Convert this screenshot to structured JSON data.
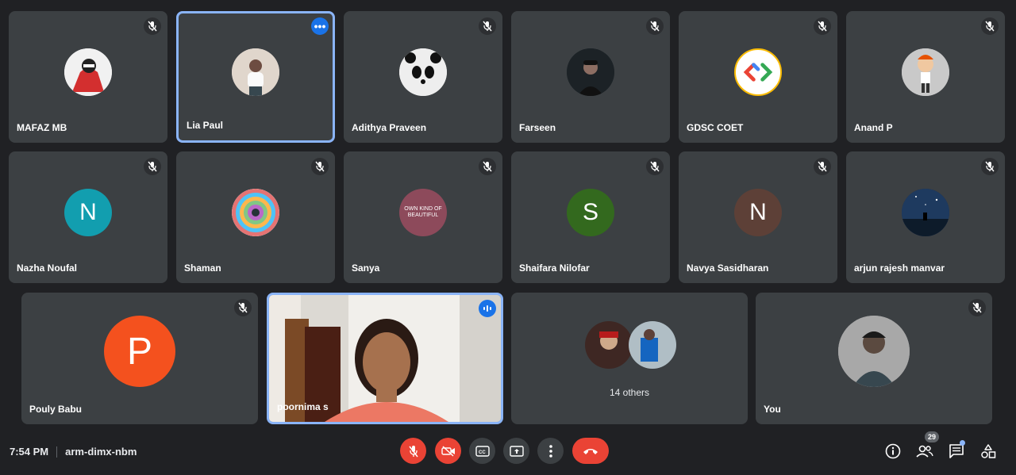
{
  "participants": [
    {
      "name": "MAFAZ MB",
      "avatar": "hacker-illustration",
      "muted": true
    },
    {
      "name": "Lia Paul",
      "avatar": "photo",
      "muted": false,
      "pinned": true
    },
    {
      "name": "Adithya Praveen",
      "avatar": "panda-photo",
      "muted": true
    },
    {
      "name": "Farseen",
      "avatar": "photo",
      "muted": true
    },
    {
      "name": "GDSC COET",
      "avatar": "gdsc-logo",
      "muted": true
    },
    {
      "name": "Anand P",
      "avatar": "cartoon",
      "muted": true
    },
    {
      "name": "Nazha Noufal",
      "initial": "N",
      "color": "#129eaf",
      "muted": true
    },
    {
      "name": "Shaman",
      "avatar": "spiral-pattern",
      "muted": true
    },
    {
      "name": "Sanya",
      "avatar": "text-image",
      "avatar_text": "OWN KIND OF BEAUTIFUL",
      "muted": true
    },
    {
      "name": "Shaifara Nilofar",
      "initial": "S",
      "color": "#33691e",
      "muted": true
    },
    {
      "name": "Navya Sasidharan",
      "initial": "N",
      "color": "#5d4037",
      "muted": true
    },
    {
      "name": "arjun rajesh manvar",
      "avatar": "night-scene",
      "muted": true
    },
    {
      "name": "Pouly Babu",
      "initial": "P",
      "color": "#f4511e",
      "muted": true
    },
    {
      "name": "poornima s",
      "video": true,
      "speaking": true
    },
    {
      "name": "You",
      "avatar": "photo",
      "muted": true
    }
  ],
  "others": {
    "label": "14 others"
  },
  "meeting": {
    "time": "7:54 PM",
    "code": "arm-dimx-nbm"
  },
  "people_count": "29",
  "colors": {
    "background": "#202124",
    "tile": "#3c4043",
    "accent": "#8ab4f8",
    "danger": "#ea4335"
  }
}
